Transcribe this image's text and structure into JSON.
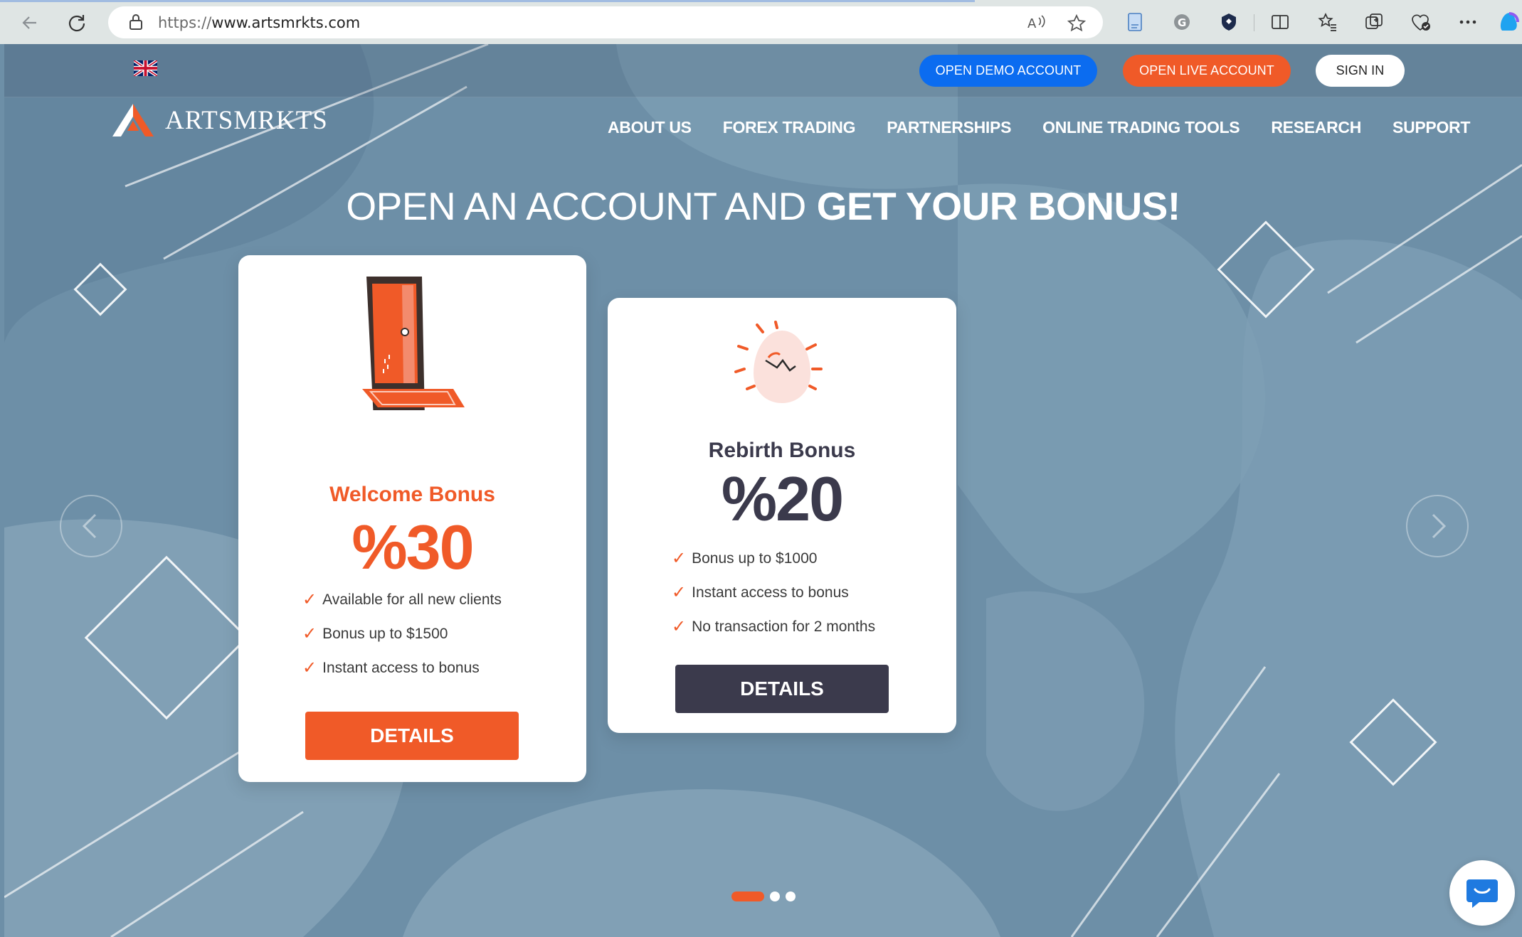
{
  "browser": {
    "url_protocol": "https://",
    "url_host": "www.artsmrkts.com"
  },
  "topbar": {
    "open_demo": "OPEN DEMO ACCOUNT",
    "open_live": "OPEN LIVE ACCOUNT",
    "sign_in": "SIGN IN"
  },
  "logo": "ARTSMRKTS",
  "menu": [
    "ABOUT US",
    "FOREX TRADING",
    "PARTNERSHIPS",
    "ONLINE TRADING TOOLS",
    "RESEARCH",
    "SUPPORT"
  ],
  "hero": {
    "headline_light": "OPEN AN ACCOUNT AND ",
    "headline_bold": "GET YOUR BONUS!"
  },
  "cards": [
    {
      "title": "Welcome Bonus",
      "percent": "%30",
      "features": [
        "Available for all new clients",
        "Bonus up to $1500",
        "Instant access to bonus"
      ],
      "button": "DETAILS",
      "accent": "#f05a28"
    },
    {
      "title": "Rebirth Bonus",
      "percent": "%20",
      "features": [
        "Bonus up to $1000",
        "Instant access to bonus",
        "No transaction for 2 months"
      ],
      "button": "DETAILS",
      "accent": "#3b3a4c"
    }
  ],
  "carousel": {
    "slides": 3,
    "active": 1
  },
  "colors": {
    "brand_orange": "#f05a28",
    "demo_blue": "#0b6cf0",
    "dark_navy": "#3b3a4c",
    "background": "#6d8fa7"
  },
  "icons": [
    "back-arrow-icon",
    "refresh-icon",
    "lock-icon",
    "read-aloud-icon",
    "favorite-star-icon",
    "extension-icon",
    "grammarly-icon",
    "shield-extension-icon",
    "split-screen-icon",
    "favorites-icon",
    "collections-icon",
    "performance-icon",
    "more-icon",
    "copilot-icon",
    "uk-flag-icon",
    "chat-icon"
  ]
}
